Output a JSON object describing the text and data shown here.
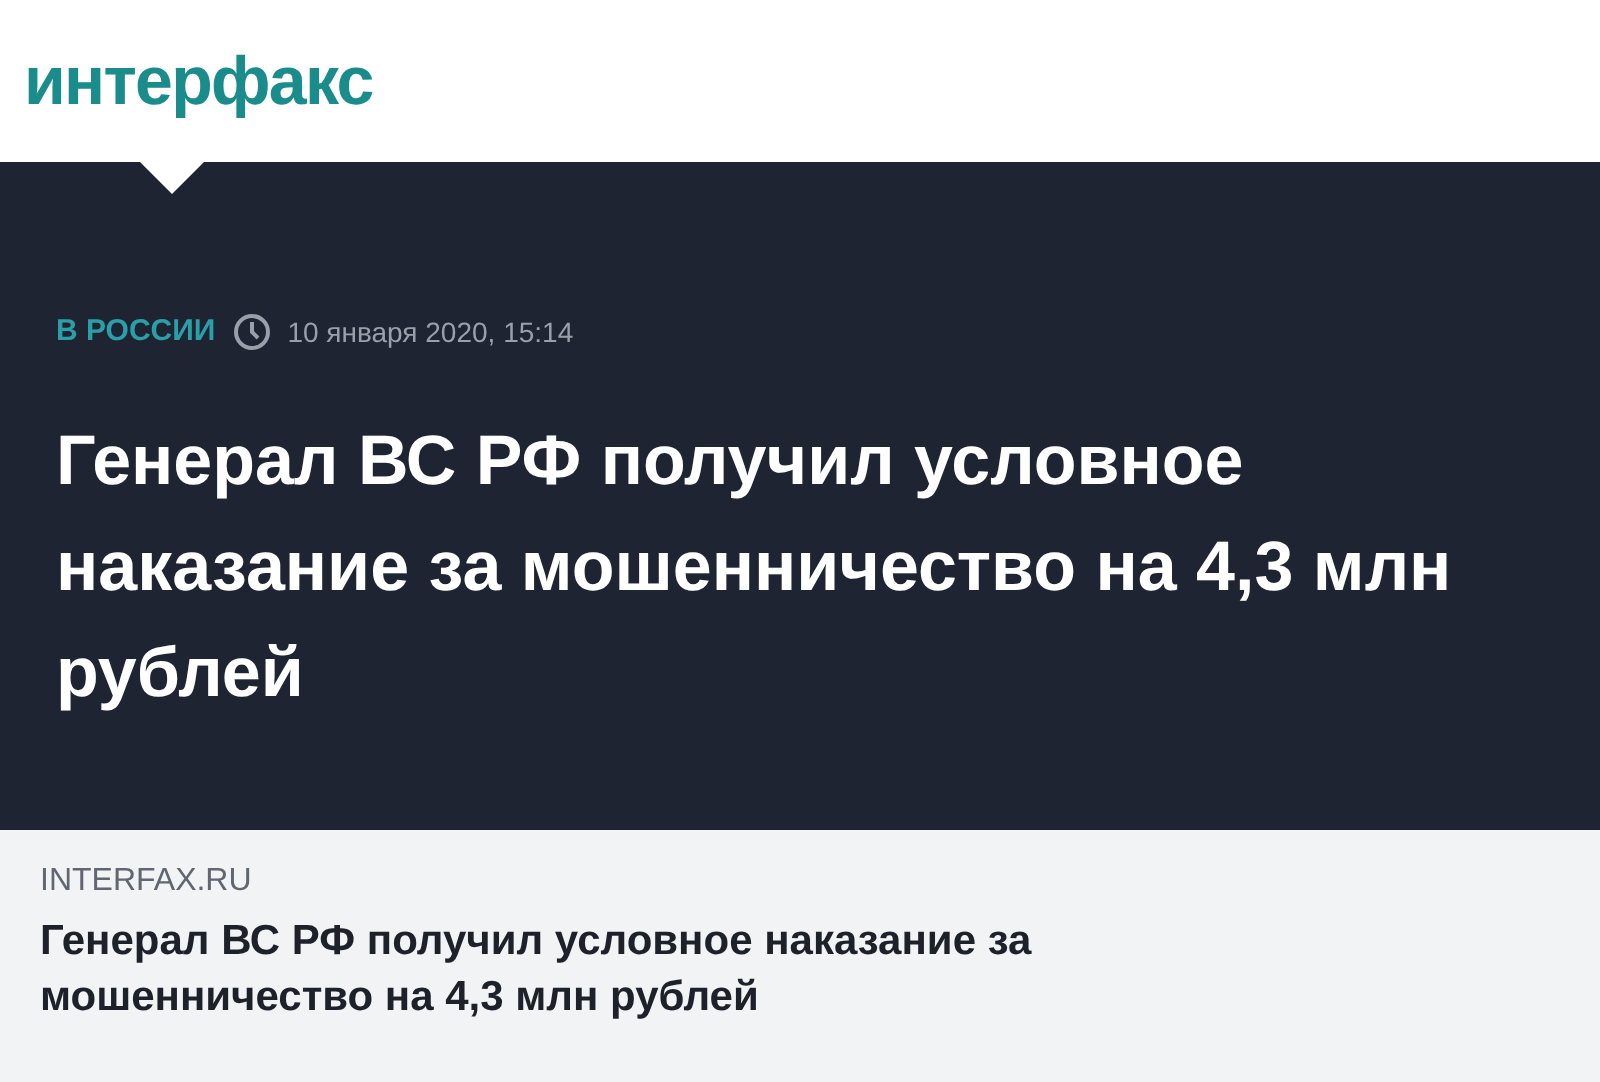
{
  "logo": "интерфакс",
  "article": {
    "category": "В РОССИИ",
    "date": "10 января 2020, 15:14",
    "headline": "Генерал ВС РФ получил условное наказание за мошенничество на 4,3 млн рублей"
  },
  "link_preview": {
    "domain": "INTERFAX.RU",
    "title": "Генерал ВС РФ получил условное наказание за мошенничество на 4,3 млн рублей"
  }
}
